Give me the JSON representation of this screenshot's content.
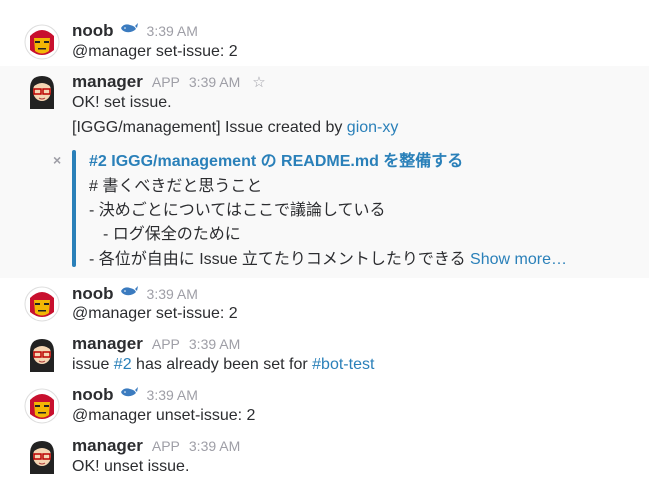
{
  "messages": [
    {
      "name": "noob",
      "time": "3:39 AM",
      "text": "@manager set-issue: 2"
    },
    {
      "name": "manager",
      "badge": "APP",
      "time": "3:39 AM",
      "line1": "OK! set issue.",
      "line2_prefix": "[IGGG/management]  Issue created by ",
      "line2_link": "gion-xy",
      "attachment": {
        "close": "×",
        "title": "#2 IGGG/management の README.md を整備する",
        "lines": [
          "# 書くべきだと思うこと",
          "- 決めごとについてはここで議論している",
          "   - ログ保全のために",
          "- 各位が自由に Issue 立てたりコメントしたりできる "
        ],
        "show_more": "Show more…"
      }
    },
    {
      "name": "noob",
      "time": "3:39 AM",
      "text": "@manager set-issue: 2"
    },
    {
      "name": "manager",
      "badge": "APP",
      "time": "3:39 AM",
      "prefix": "issue ",
      "link1": "#2",
      "middle": " has already been set for ",
      "link2": "#bot-test"
    },
    {
      "name": "noob",
      "time": "3:39 AM",
      "text": "@manager unset-issue: 2"
    },
    {
      "name": "manager",
      "badge": "APP",
      "time": "3:39 AM",
      "text": "OK! unset issue."
    }
  ],
  "colors": {
    "link": "#2a80b9",
    "highlight_bg": "#f9f9f9",
    "muted": "#9e9ea6"
  },
  "icons": {
    "noob_avatar": "iron-man-helmet-icon",
    "manager_avatar": "person-with-glasses-icon",
    "whale": "whale-icon",
    "star": "star-icon"
  }
}
